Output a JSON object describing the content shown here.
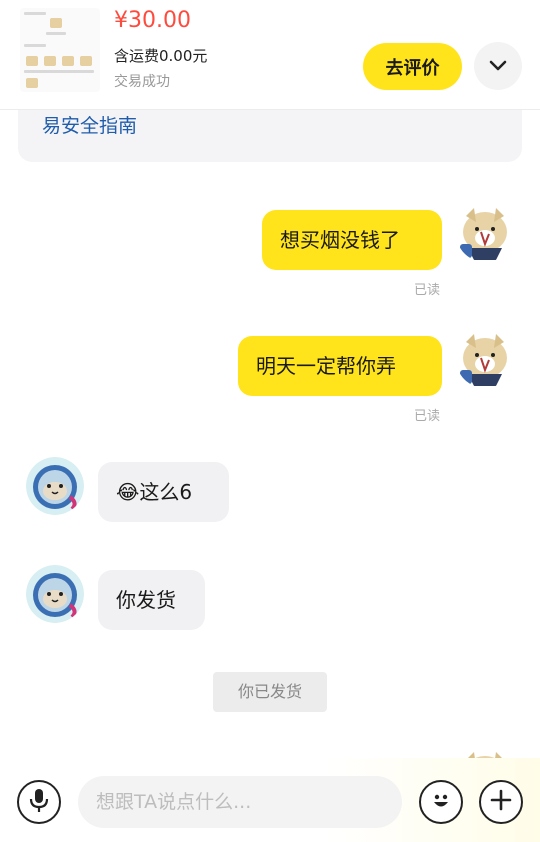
{
  "order": {
    "price": "¥30.00",
    "shipping": "含运费0.00元",
    "status": "交易成功",
    "review_label": "去评价"
  },
  "guide": {
    "text": "易安全指南"
  },
  "messages": [
    {
      "side": "me",
      "text": "想买烟没钱了",
      "read_label": "已读"
    },
    {
      "side": "me",
      "text": "明天一定帮你弄",
      "read_label": "已读"
    },
    {
      "side": "them",
      "emoji": "😂",
      "text": "这么6"
    },
    {
      "side": "them",
      "text": "你发货"
    }
  ],
  "system_note": "你已发货",
  "input": {
    "placeholder": "想跟TA说点什么..."
  },
  "colors": {
    "accent_yellow": "#ffe41b",
    "price_red": "#ff4b3e",
    "link_blue": "#1f5cab"
  },
  "icons": [
    "chevron-down-icon",
    "microphone-icon",
    "emoji-icon",
    "plus-icon"
  ]
}
